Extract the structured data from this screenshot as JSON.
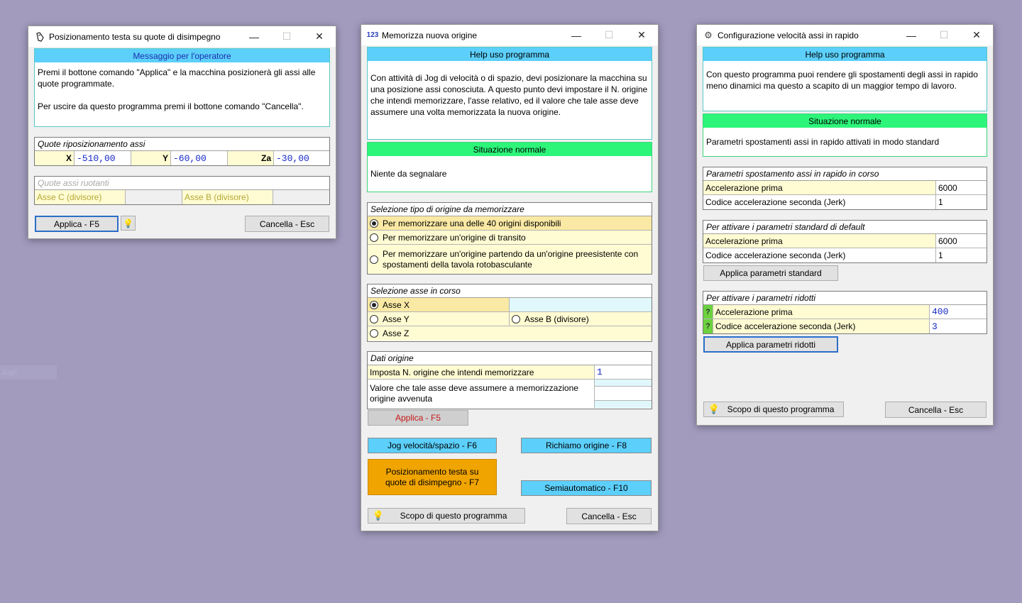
{
  "desktop": {
    "ghost_label": "Jogn"
  },
  "win1": {
    "title": "Posizionamento testa su quote di disimpegno",
    "msg_header": "Messaggio per l'operatore",
    "msg_line1": "Premi il bottone comando \"Applica\" e la macchina posizionerà gli assi alle quote programmate.",
    "msg_line2": "Per uscire da questo programma premi il bottone comando \"Cancella\".",
    "quote_title": "Quote riposizionamento assi",
    "axes": [
      {
        "label": "X",
        "value": "-510,00"
      },
      {
        "label": "Y",
        "value": "-60,00"
      },
      {
        "label": "Za",
        "value": "-30,00"
      }
    ],
    "rot_title": "Quote assi ruotanti",
    "rot_c": "Asse C (divisore)",
    "rot_b": "Asse B (divisore)",
    "apply_btn": "Applica - F5",
    "cancel_btn": "Cancella - Esc"
  },
  "win2": {
    "title": "Memorizza nuova origine",
    "help_header": "Help uso programma",
    "help_text": "Con attività di Jog di velocità o di spazio, devi posizionare la macchina su una posizione assi conosciuta. A questo punto devi impostare il N. origine che intendi memorizzare, l'asse relativo, ed il valore che tale asse deve assumere una volta memorizzata la nuova origine.",
    "status_header": "Situazione normale",
    "status_text": "Niente da segnalare",
    "type_title": "Selezione tipo di origine da memorizzare",
    "type_options": [
      "Per memorizzare una delle 40 origini disponibili",
      "Per memorizzare un'origine di transito",
      "Per memorizzare un'origine partendo da un'origine preesistente con spostamenti della tavola rotobasculante"
    ],
    "axis_title": "Selezione asse in corso",
    "axis_x": "Asse X",
    "axis_y": "Asse Y",
    "axis_b": "Asse B (divisore)",
    "axis_z": "Asse Z",
    "data_title": "Dati origine",
    "origin_num_label": "Imposta N. origine che intendi memorizzare",
    "origin_num_value": "1",
    "origin_val_label": "Valore che tale asse deve assumere a memorizzazione origine avvenuta",
    "apply_btn": "Applica - F5",
    "jog_btn": "Jog velocità/spazio - F6",
    "recall_btn": "Richiamo origine - F8",
    "pos_btn": "Posizionamento testa su quote di disimpegno - F7",
    "semi_btn": "Semiautomatico - F10",
    "scope_btn": "Scopo di questo programma",
    "cancel_btn": "Cancella - Esc"
  },
  "win3": {
    "title": "Configurazione velocità assi in rapido",
    "help_header": "Help uso programma",
    "help_text": "Con questo programma puoi rendere gli spostamenti degli assi in rapido meno dinamici ma questo a scapito di un maggior tempo di lavoro.",
    "status_header": "Situazione normale",
    "status_text": "Parametri spostamenti assi in rapido attivati in modo standard",
    "cur_title": "Parametri spostamento assi in rapido in corso",
    "cur_acc_label": "Accelerazione prima",
    "cur_acc_value": "6000",
    "cur_jerk_label": "Codice accelerazione seconda (Jerk)",
    "cur_jerk_value": "1",
    "std_title": "Per attivare i parametri standard di default",
    "std_acc_label": "Accelerazione prima",
    "std_acc_value": "6000",
    "std_jerk_label": "Codice accelerazione seconda (Jerk)",
    "std_jerk_value": "1",
    "std_btn": "Applica parametri standard",
    "red_title": "Per attivare i parametri ridotti",
    "red_acc_label": "Accelerazione prima",
    "red_acc_value": "400",
    "red_jerk_label": "Codice accelerazione seconda (Jerk)",
    "red_jerk_value": "3",
    "red_btn": "Applica parametri ridotti",
    "qmark": "?",
    "scope_btn": "Scopo di questo programma",
    "cancel_btn": "Cancella - Esc"
  }
}
